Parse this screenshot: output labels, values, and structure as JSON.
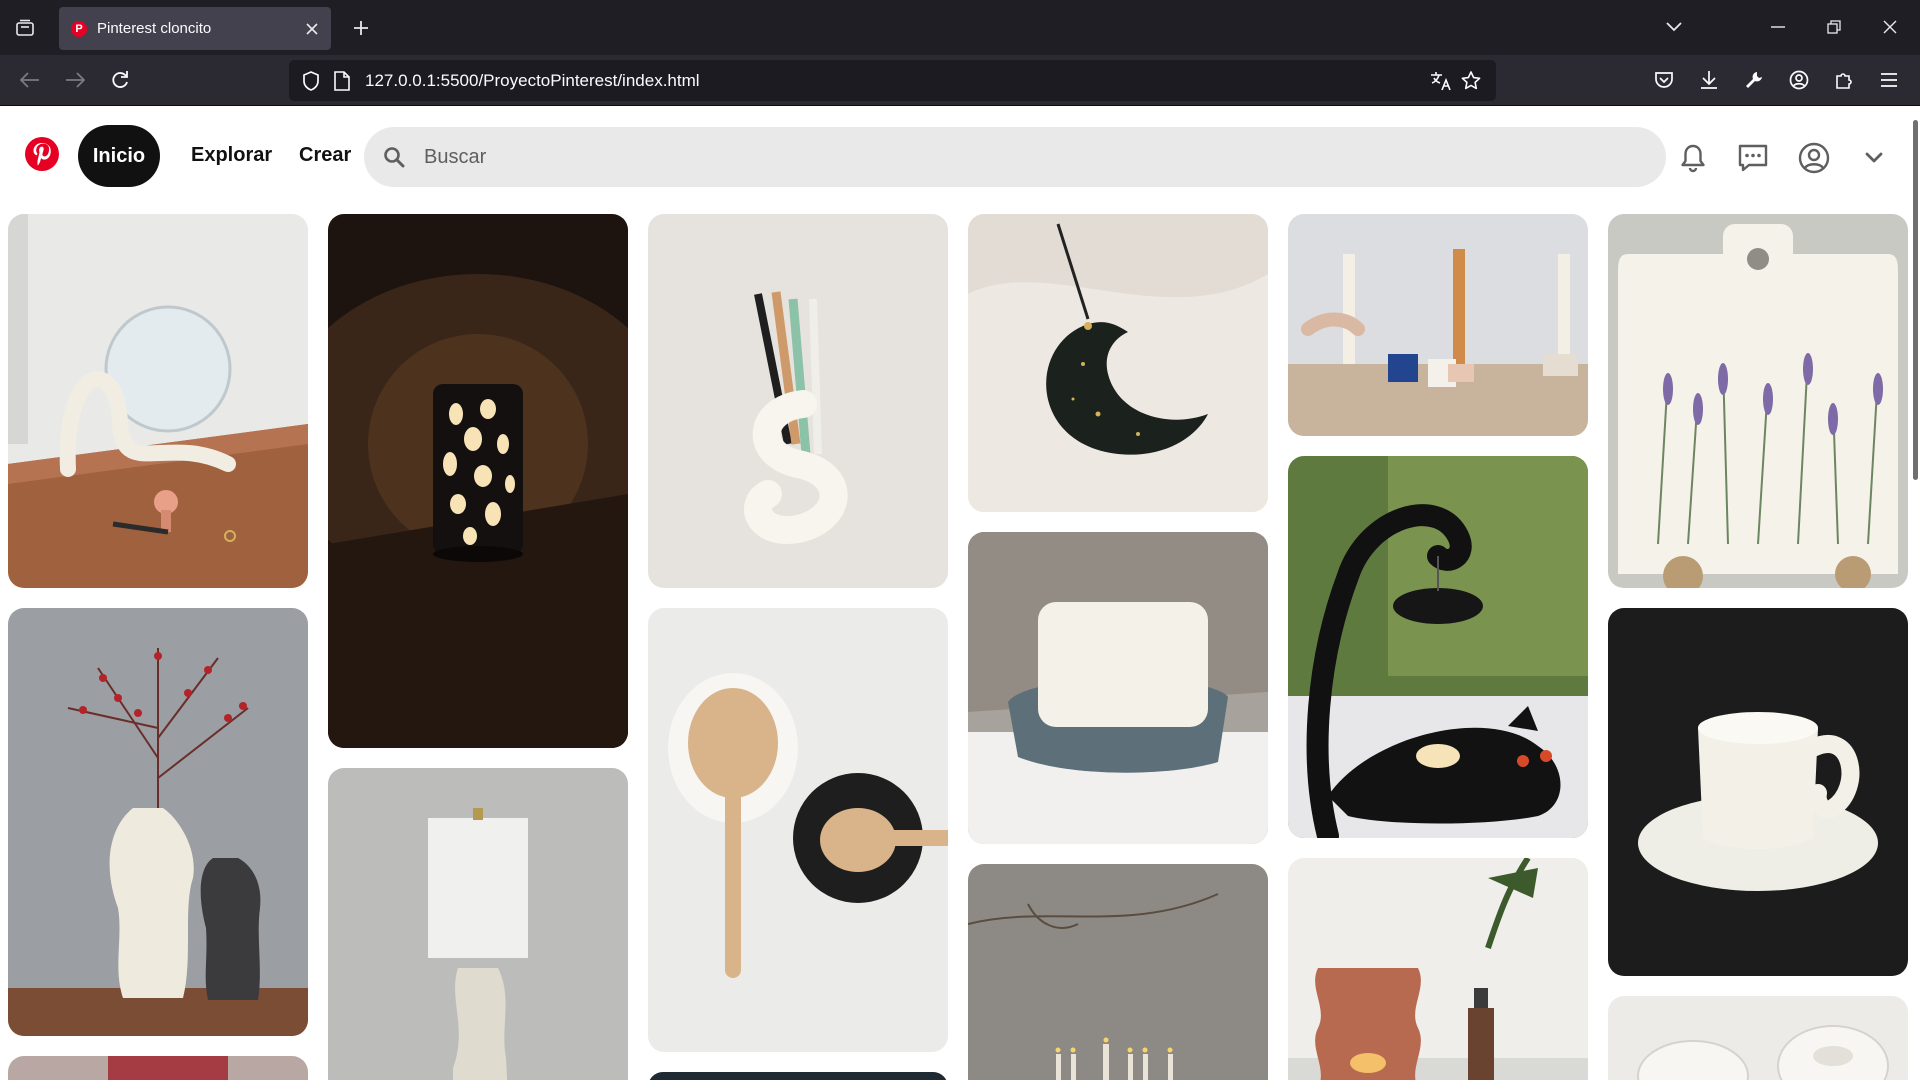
{
  "browser": {
    "tab_title": "Pinterest cloncito",
    "tab_favicon": "P",
    "url": "127.0.0.1:5500/ProyectoPinterest/index.html"
  },
  "header": {
    "home_label": "Inicio",
    "explore_label": "Explorar",
    "create_label": "Crear",
    "search_placeholder": "Buscar"
  },
  "icons": {
    "tab_list": "tab-list-icon",
    "new_tab": "plus-icon",
    "logo": "pinterest-logo-icon",
    "search": "search-icon",
    "notifications": "bell-icon",
    "messages": "chat-icon",
    "profile": "user-circle-icon",
    "menu": "chevron-down-icon"
  },
  "colors": {
    "brand": "#e60023",
    "home_pill": "#111111",
    "search_bg": "#e9e9e9"
  },
  "pins": [
    {
      "id": "mirror-stand"
    },
    {
      "id": "lantern-lamp"
    },
    {
      "id": "toothbrush-holder"
    },
    {
      "id": "moon-incense-holder"
    },
    {
      "id": "candle-holders"
    },
    {
      "id": "lavender-board"
    },
    {
      "id": "textured-vases"
    },
    {
      "id": "spoon-rests"
    },
    {
      "id": "soap-dish"
    },
    {
      "id": "cat-oil-burner"
    },
    {
      "id": "ear-cup"
    },
    {
      "id": "table-lamp"
    },
    {
      "id": "candles-branch"
    },
    {
      "id": "wax-melter"
    },
    {
      "id": "bowls"
    },
    {
      "id": "partial-pin"
    },
    {
      "id": "partial-pin-2"
    }
  ]
}
